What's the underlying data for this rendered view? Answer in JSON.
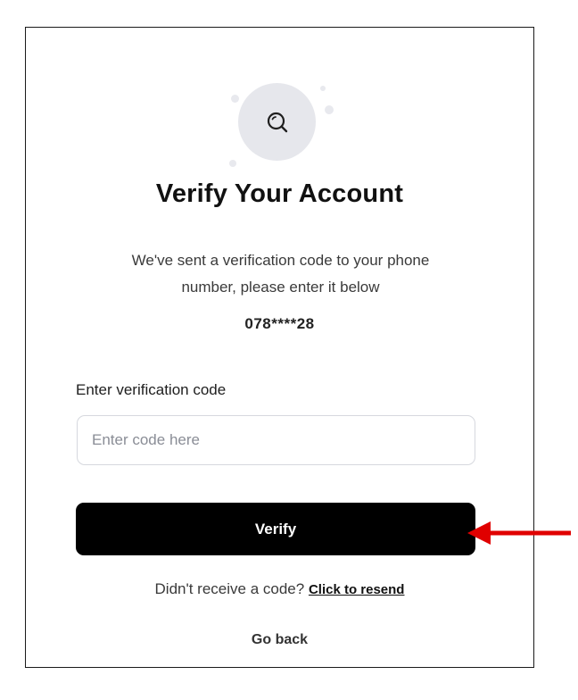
{
  "header": {
    "title": "Verify Your Account",
    "subtitle_line1": "We've sent a verification code to your phone",
    "subtitle_line2": "number, please enter it below",
    "masked_phone": "078****28",
    "icon": "search-icon"
  },
  "form": {
    "code_label": "Enter verification code",
    "code_placeholder": "Enter code here",
    "code_value": ""
  },
  "actions": {
    "verify_label": "Verify",
    "resend_prompt": "Didn't receive a code?",
    "resend_link": "Click to resend",
    "go_back": "Go back"
  },
  "colors": {
    "primary_button": "#000000",
    "icon_circle": "#e6e7ec",
    "annotation_arrow": "#e00000"
  }
}
